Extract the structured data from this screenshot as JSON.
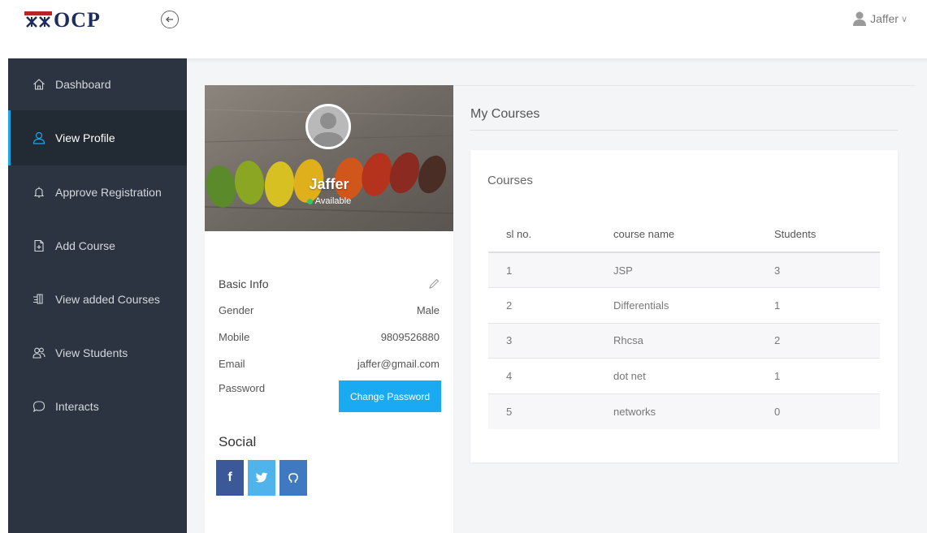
{
  "header": {
    "logo_text": "OCP",
    "user_name": "Jaffer"
  },
  "sidebar": {
    "items": [
      {
        "label": "Dashboard",
        "icon": "home-icon"
      },
      {
        "label": "View Profile",
        "icon": "user-icon"
      },
      {
        "label": "Approve Registration",
        "icon": "bell-icon"
      },
      {
        "label": "Add Course",
        "icon": "add-file-icon"
      },
      {
        "label": "View added Courses",
        "icon": "book-icon"
      },
      {
        "label": "View Students",
        "icon": "users-icon"
      },
      {
        "label": "Interacts",
        "icon": "chat-icon"
      }
    ]
  },
  "profile": {
    "name": "Jaffer",
    "status": "Available",
    "basic_info_label": "Basic Info",
    "rows": [
      {
        "label": "Gender",
        "value": "Male"
      },
      {
        "label": "Mobile",
        "value": "9809526880"
      },
      {
        "label": "Email",
        "value": "jaffer@gmail.com"
      }
    ],
    "password_label": "Password",
    "change_password_label": "Change Password",
    "social_title": "Social",
    "social": [
      "f",
      "t",
      "gh"
    ]
  },
  "courses": {
    "section_title": "My Courses",
    "card_title": "Courses",
    "columns": [
      "sl no.",
      "course name",
      "Students"
    ],
    "rows": [
      [
        "1",
        "JSP",
        "3"
      ],
      [
        "2",
        "Differentials",
        "1"
      ],
      [
        "3",
        "Rhcsa",
        "2"
      ],
      [
        "4",
        "dot net",
        "1"
      ],
      [
        "5",
        "networks",
        "0"
      ]
    ]
  },
  "colors": {
    "sidebar_bg": "#2b3440",
    "accent": "#16a8e8",
    "button": "#19aaf1",
    "facebook": "#3b5998",
    "twitter": "#4fb3ec",
    "github": "#3f7ac0",
    "status_green": "#3cc561"
  }
}
